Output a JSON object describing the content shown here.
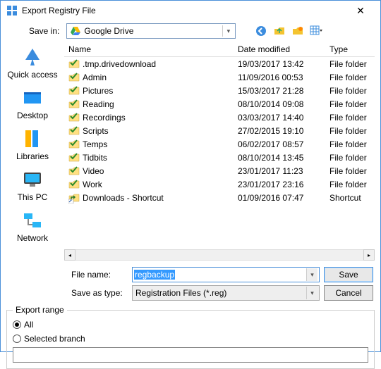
{
  "window": {
    "title": "Export Registry File"
  },
  "topbar": {
    "savein_label": "Save in:",
    "savein_value": "Google Drive"
  },
  "places": [
    {
      "label": "Quick access"
    },
    {
      "label": "Desktop"
    },
    {
      "label": "Libraries"
    },
    {
      "label": "This PC"
    },
    {
      "label": "Network"
    }
  ],
  "columns": {
    "name": "Name",
    "date": "Date modified",
    "type": "Type"
  },
  "rows": [
    {
      "name": ".tmp.drivedownload",
      "date": "19/03/2017 13:42",
      "type": "File folder",
      "kind": "folder"
    },
    {
      "name": "Admin",
      "date": "11/09/2016 00:53",
      "type": "File folder",
      "kind": "folder"
    },
    {
      "name": "Pictures",
      "date": "15/03/2017 21:28",
      "type": "File folder",
      "kind": "folder"
    },
    {
      "name": "Reading",
      "date": "08/10/2014 09:08",
      "type": "File folder",
      "kind": "folder"
    },
    {
      "name": "Recordings",
      "date": "03/03/2017 14:40",
      "type": "File folder",
      "kind": "folder"
    },
    {
      "name": "Scripts",
      "date": "27/02/2015 19:10",
      "type": "File folder",
      "kind": "folder"
    },
    {
      "name": "Temps",
      "date": "06/02/2017 08:57",
      "type": "File folder",
      "kind": "folder"
    },
    {
      "name": "Tidbits",
      "date": "08/10/2014 13:45",
      "type": "File folder",
      "kind": "folder"
    },
    {
      "name": "Video",
      "date": "23/01/2017 11:23",
      "type": "File folder",
      "kind": "folder"
    },
    {
      "name": "Work",
      "date": "23/01/2017 23:16",
      "type": "File folder",
      "kind": "folder"
    },
    {
      "name": "Downloads - Shortcut",
      "date": "01/09/2016 07:47",
      "type": "Shortcut",
      "kind": "shortcut"
    }
  ],
  "form": {
    "filename_label": "File name:",
    "filename_value": "regbackup",
    "type_label": "Save as type:",
    "type_value": "Registration Files (*.reg)",
    "save": "Save",
    "cancel": "Cancel"
  },
  "export": {
    "legend": "Export range",
    "all": "All",
    "selected": "Selected branch"
  }
}
